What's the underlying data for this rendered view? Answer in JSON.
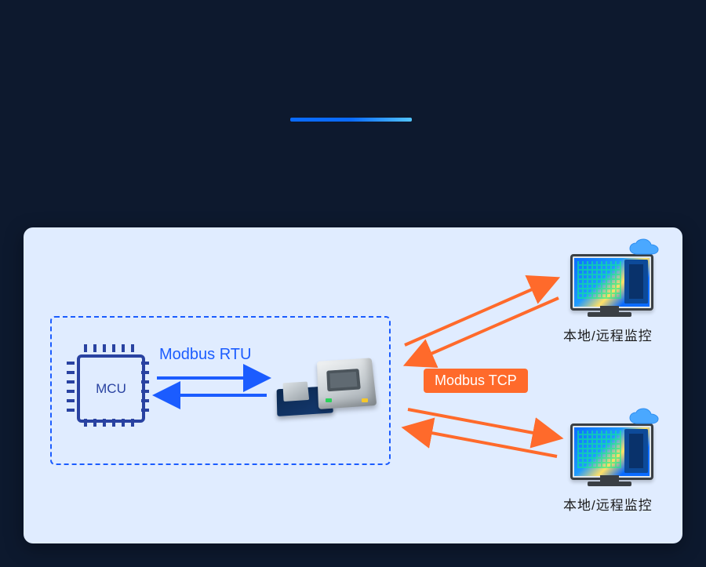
{
  "labels": {
    "mcu": "MCU",
    "rtu": "Modbus RTU",
    "tcp": "Modbus TCP",
    "monitor_top": "本地/远程监控",
    "monitor_bottom": "本地/远程监控"
  },
  "colors": {
    "bg": "#0d192e",
    "panel": "#e0ecff",
    "dashed": "#1b5cff",
    "arrow_blue": "#1b5cff",
    "arrow_orange": "#ff6a2b",
    "pill_orange": "#ff6a2b",
    "chip_stroke": "#2942a1"
  },
  "diagram": {
    "nodes": [
      {
        "id": "mcu",
        "type": "mcu-chip",
        "group": "local"
      },
      {
        "id": "gateway",
        "type": "ethernet-module",
        "group": "local"
      },
      {
        "id": "monitor_top",
        "type": "pc-monitor-with-cloud",
        "group": "remote"
      },
      {
        "id": "monitor_bottom",
        "type": "pc-monitor-with-cloud",
        "group": "remote"
      }
    ],
    "groups": [
      {
        "id": "local",
        "style": "dashed-blue",
        "contains": [
          "mcu",
          "gateway"
        ]
      }
    ],
    "links": [
      {
        "from": "mcu",
        "to": "gateway",
        "label": "Modbus RTU",
        "protocol": "modbus-rtu",
        "color": "blue",
        "bidirectional": true
      },
      {
        "from": "gateway",
        "to": "monitor_top",
        "label": "Modbus TCP",
        "protocol": "modbus-tcp",
        "color": "orange",
        "bidirectional": true
      },
      {
        "from": "gateway",
        "to": "monitor_bottom",
        "label": "Modbus TCP",
        "protocol": "modbus-tcp",
        "color": "orange",
        "bidirectional": true
      }
    ]
  }
}
